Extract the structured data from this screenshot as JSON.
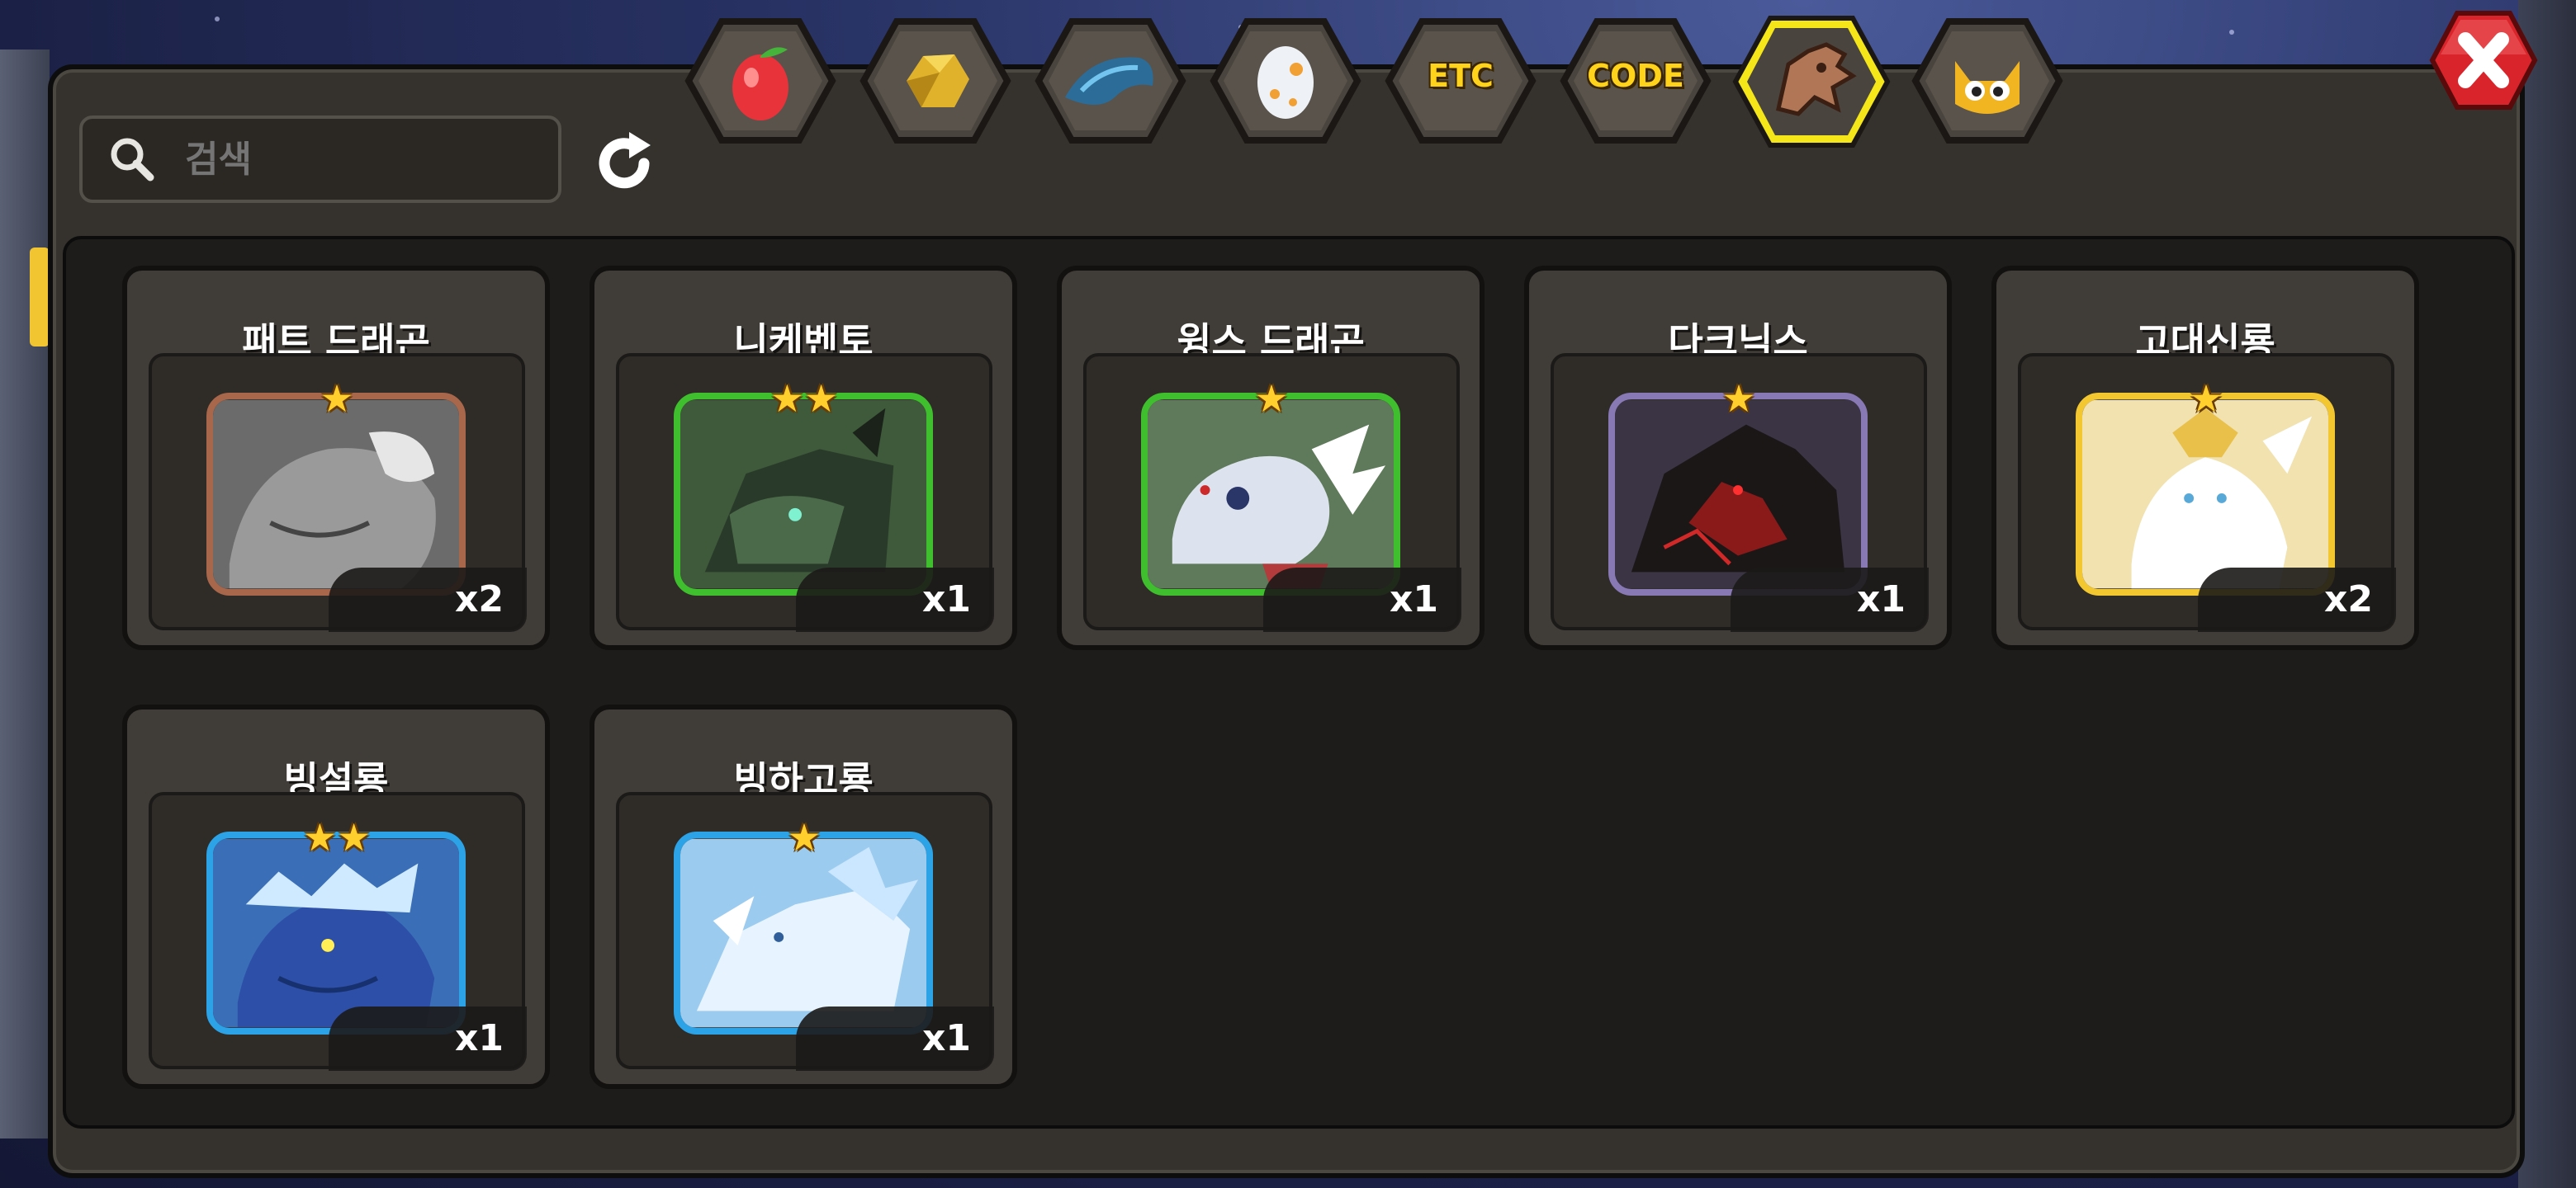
{
  "search": {
    "placeholder": "검색"
  },
  "tabs": [
    {
      "id": "fruit",
      "icon": "fruit-icon",
      "selected": false
    },
    {
      "id": "gold",
      "icon": "gold-ore-icon",
      "selected": false
    },
    {
      "id": "scale",
      "icon": "dragon-scale-icon",
      "selected": false
    },
    {
      "id": "egg",
      "icon": "egg-icon",
      "selected": false
    },
    {
      "id": "etc",
      "label": "ETC",
      "selected": false
    },
    {
      "id": "code",
      "label": "CODE",
      "selected": false
    },
    {
      "id": "dragon",
      "icon": "dragon-head-icon",
      "selected": true
    },
    {
      "id": "pet",
      "icon": "owl-icon",
      "selected": false
    }
  ],
  "dragons": [
    {
      "name": "패트 드래곤",
      "stars": "★",
      "count": "x2",
      "frame": "#a8674a",
      "theme": "stone"
    },
    {
      "name": "니케벤토",
      "stars": "★★",
      "count": "x1",
      "frame": "#3fbf2d",
      "theme": "dark-green"
    },
    {
      "name": "윙스 드래곤",
      "stars": "★",
      "count": "x1",
      "frame": "#3fbf2d",
      "theme": "white"
    },
    {
      "name": "다크닉스",
      "stars": "★",
      "count": "x1",
      "frame": "#8878b4",
      "theme": "dark-red"
    },
    {
      "name": "고대신룡",
      "stars": "★",
      "count": "x2",
      "frame": "#f3c730",
      "theme": "holy"
    },
    {
      "name": "빙설룡",
      "stars": "★★",
      "count": "x1",
      "frame": "#2ca3e6",
      "theme": "ice-blue"
    },
    {
      "name": "빙하고룡",
      "stars": "★",
      "count": "x1",
      "frame": "#2ca3e6",
      "theme": "glacier"
    }
  ],
  "colors": {
    "tab_selected": "#f5e61a",
    "tab_border": "#1a1714",
    "close_red": "#d8242a"
  }
}
